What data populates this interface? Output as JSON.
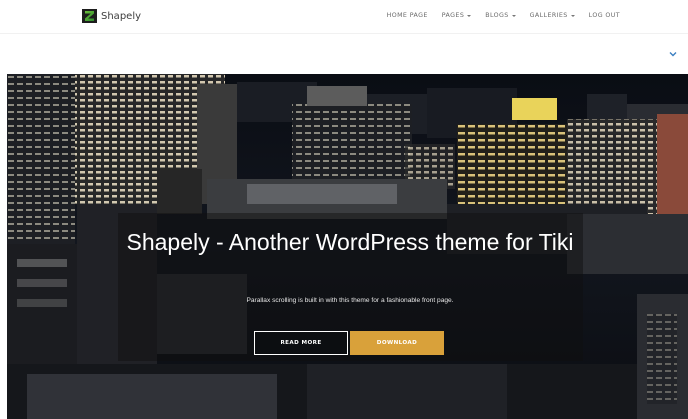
{
  "site": {
    "name": "Shapely"
  },
  "nav": {
    "items": [
      {
        "label": "HOME PAGE",
        "has_caret": false
      },
      {
        "label": "PAGES",
        "has_caret": true
      },
      {
        "label": "BLOGS",
        "has_caret": true
      },
      {
        "label": "GALLERIES",
        "has_caret": true
      },
      {
        "label": "LOG OUT",
        "has_caret": false
      }
    ]
  },
  "toggle": {
    "icon": "chevron-down-icon",
    "color": "#3a7fc1"
  },
  "hero": {
    "title": "Shapely - Another WordPress theme for Tiki",
    "subtitle": "Parallax scrolling is built in with this theme for a fashionable front page.",
    "buttons": {
      "read_more": "READ MORE",
      "download": "DOWNLOAD"
    }
  },
  "colors": {
    "accent": "#d9a13a",
    "nav_text": "#6b6b6b"
  }
}
